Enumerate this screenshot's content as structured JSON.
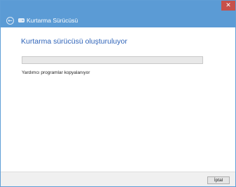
{
  "window": {
    "title": "Kurtarma Sürücüsü",
    "close_glyph": "✕",
    "back_glyph": "←",
    "icons": {
      "back": "back-arrow-icon",
      "drive": "drive-icon",
      "close": "close-icon"
    }
  },
  "main": {
    "heading": "Kurtarma sürücüsü oluşturuluyor",
    "progress_value": 0,
    "status_text": "Yardımcı programlar kopyalanıyor"
  },
  "footer": {
    "cancel_label": "İptal"
  },
  "colors": {
    "titlebar": "#5b9bd5",
    "close_button": "#c7504b",
    "heading": "#2e63b8",
    "progress_track": "#e8e8e8",
    "progress_fill": "#06b025",
    "footer": "#f0f0f0"
  }
}
